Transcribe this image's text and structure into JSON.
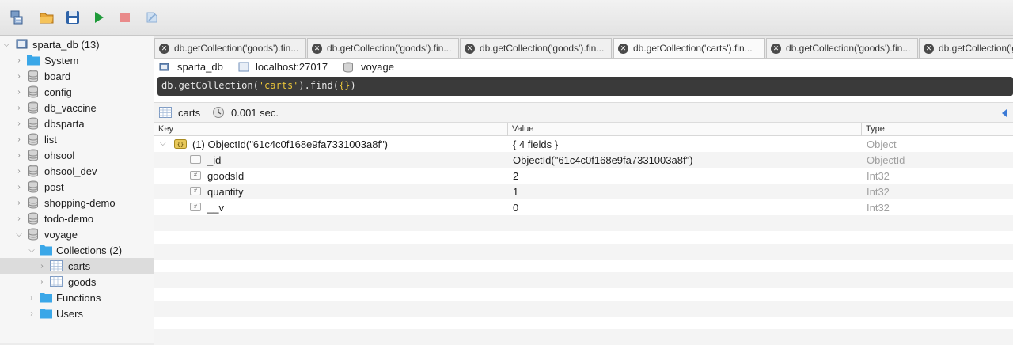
{
  "toolbar": {
    "buttons": [
      "connect-icon",
      "open-icon",
      "save-icon",
      "run-icon",
      "stop-icon",
      "format-icon"
    ]
  },
  "sidebar": {
    "root": {
      "label": "sparta_db (13)"
    },
    "databases": [
      "System",
      "board",
      "config",
      "db_vaccine",
      "dbsparta",
      "list",
      "ohsool",
      "ohsool_dev",
      "post",
      "shopping-demo",
      "todo-demo",
      "voyage"
    ],
    "collections_label": "Collections (2)",
    "collections": [
      "carts",
      "goods"
    ],
    "functions_label": "Functions",
    "users_label": "Users"
  },
  "tabs": [
    {
      "label": "db.getCollection('goods').fin..."
    },
    {
      "label": "db.getCollection('goods').fin..."
    },
    {
      "label": "db.getCollection('goods').fin..."
    },
    {
      "label": "db.getCollection('carts').fin..."
    },
    {
      "label": "db.getCollection('goods').fin..."
    },
    {
      "label": "db.getCollection('g"
    }
  ],
  "info": {
    "connection": "sparta_db",
    "host": "localhost:27017",
    "database": "voyage"
  },
  "query": {
    "prefix": "db.getCollection(",
    "arg": "'carts'",
    "suffix": ").find(",
    "braces": "{}",
    "close": ")"
  },
  "result": {
    "collection": "carts",
    "time": "0.001 sec."
  },
  "grid": {
    "headers": {
      "key": "Key",
      "value": "Value",
      "type": "Type"
    },
    "document": {
      "key": "(1) ObjectId(\"61c4c0f168e9fa7331003a8f\")",
      "value": "{ 4 fields }",
      "type": "Object"
    },
    "fields": [
      {
        "key": "_id",
        "value": "ObjectId(\"61c4c0f168e9fa7331003a8f\")",
        "type": "ObjectId"
      },
      {
        "key": "goodsId",
        "value": "2",
        "type": "Int32"
      },
      {
        "key": "quantity",
        "value": "1",
        "type": "Int32"
      },
      {
        "key": "__v",
        "value": "0",
        "type": "Int32"
      }
    ]
  },
  "colors": {
    "folder": "#3aa7e8",
    "db": "#9a9a9a",
    "run": "#1f9a3a",
    "stop": "#e05050",
    "query_bg": "#3a3a3a",
    "query_string": "#e6c23a"
  }
}
